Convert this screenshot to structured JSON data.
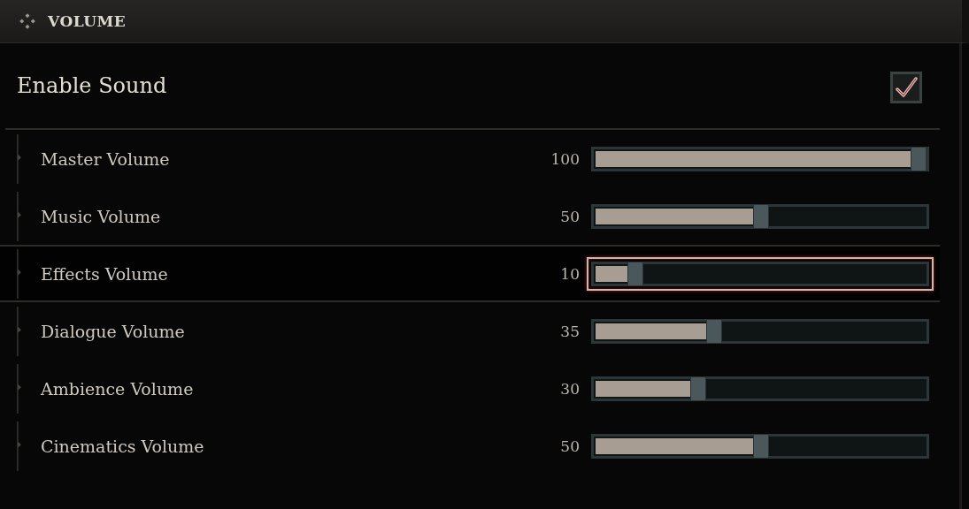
{
  "section": {
    "title": "VOLUME"
  },
  "enable_sound": {
    "label": "Enable Sound",
    "checked": true
  },
  "sliders": [
    {
      "label": "Master Volume",
      "reading": "100",
      "level": 1.0,
      "selected": false
    },
    {
      "label": "Music Volume",
      "reading": "50",
      "level": 0.5,
      "selected": false
    },
    {
      "label": "Effects Volume",
      "reading": "10",
      "level": 0.1,
      "selected": true
    },
    {
      "label": "Dialogue Volume",
      "reading": "35",
      "level": 0.35,
      "selected": false
    },
    {
      "label": "Ambience Volume",
      "reading": "30",
      "level": 0.3,
      "selected": false
    },
    {
      "label": "Cinematics Volume",
      "reading": "50",
      "level": 0.5,
      "selected": false
    }
  ]
}
